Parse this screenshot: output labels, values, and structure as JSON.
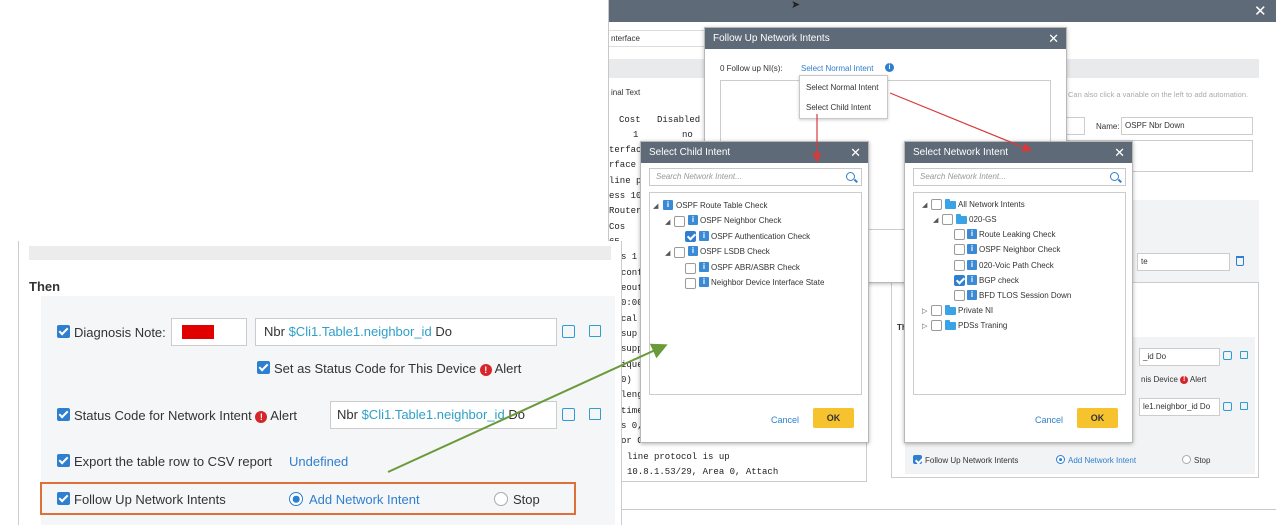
{
  "bg": {
    "interface_text": "nterface",
    "final_text": "inal Text",
    "table_header": [
      "Cost",
      "Disabled"
    ],
    "table_row": [
      "1",
      "no"
    ],
    "cli_lines": [
      "terface",
      "rface i",
      "line pr",
      "ess 10.",
      " Router",
      "   Cos",
      "   65",
      "s 1",
      "conf",
      "eout",
      "0:00",
      "cal",
      " sup",
      "supp",
      "ique",
      "0)",
      "leng",
      "time",
      "s 0,",
      "or C"
    ],
    "cli_bottom": [
      " line protocol is up",
      " 10.8.1.53/29, Area 0, Attach"
    ],
    "hint": "Can also click a variable on the left to add automation.",
    "name_label": "Name:",
    "name_value": "OSPF Nbr Down",
    "te_value": "te",
    "th_text": "Th",
    "do_value": "_id Do",
    "device_text": "nis Device",
    "alert_text": "Alert",
    "neighbor_value": "le1.neighbor_id Do",
    "follow_up": "Follow Up Network Intents",
    "add_ni": "Add Network Intent",
    "stop": "Stop"
  },
  "follow_dialog": {
    "title": "Follow Up Network Intents",
    "count_label": "0 Follow up NI(s):",
    "select_link": "Select Normal Intent",
    "menu": [
      "Select Normal Intent",
      "Select Child Intent"
    ]
  },
  "child_dialog": {
    "title": "Select Child Intent",
    "search_placeholder": "Search Network Intent...",
    "tree": [
      {
        "label": "OSPF Route Table Check",
        "checked": false,
        "level": 0,
        "toggle": "▲",
        "cb": false
      },
      {
        "label": "OSPF Neighbor Check",
        "checked": false,
        "level": 1,
        "toggle": "◢",
        "cb": true
      },
      {
        "label": "OSPF Authentication Check",
        "checked": true,
        "level": 2,
        "toggle": "",
        "cb": true
      },
      {
        "label": "OSPF LSDB Check",
        "checked": false,
        "level": 1,
        "toggle": "◢",
        "cb": true
      },
      {
        "label": "OSPF ABR/ASBR Check",
        "checked": false,
        "level": 2,
        "toggle": "",
        "cb": true
      },
      {
        "label": "Neighbor Device Interface State",
        "checked": false,
        "level": 2,
        "toggle": "",
        "cb": true
      }
    ],
    "cancel": "Cancel",
    "ok": "OK"
  },
  "network_dialog": {
    "title": "Select Network Intent",
    "search_placeholder": "Search Network Intent...",
    "tree": [
      {
        "label": "All Network Intents",
        "checked": false,
        "level": 0,
        "toggle": "◢",
        "type": "folder"
      },
      {
        "label": "020-GS",
        "checked": false,
        "level": 1,
        "toggle": "◢",
        "type": "folder"
      },
      {
        "label": "Route Leaking Check",
        "checked": false,
        "level": 2,
        "toggle": "",
        "type": "ni"
      },
      {
        "label": "OSPF Neighbor Check",
        "checked": false,
        "level": 2,
        "toggle": "",
        "type": "ni"
      },
      {
        "label": "020-Voic Path Check",
        "checked": false,
        "level": 2,
        "toggle": "",
        "type": "ni"
      },
      {
        "label": "BGP check",
        "checked": true,
        "level": 2,
        "toggle": "",
        "type": "ni"
      },
      {
        "label": "BFD TLOS Session Down",
        "checked": false,
        "level": 2,
        "toggle": "",
        "type": "ni"
      },
      {
        "label": "Private NI",
        "checked": false,
        "level": 0,
        "toggle": "▷",
        "type": "folder"
      },
      {
        "label": "PDSs Traning",
        "checked": false,
        "level": 0,
        "toggle": "▷",
        "type": "folder"
      }
    ],
    "cancel": "Cancel",
    "ok": "OK"
  },
  "zoom": {
    "then": "Then",
    "diag_label": "Diagnosis Note:",
    "diag_prefix": "Nbr",
    "diag_var": "$Cli1.Table1.neighbor_id",
    "diag_suffix": "Do",
    "status_set": "Set as Status Code for This Device",
    "alert": "Alert",
    "status_label": "Status Code for Network Intent",
    "status_prefix": "Nbr",
    "status_var": "$Cli1.Table1.neighbor_id",
    "status_suffix": "Do",
    "export_label": "Export the table row to CSV report",
    "export_value": "Undefined",
    "follow_label": "Follow Up Network Intents",
    "add_label": "Add Network Intent",
    "stop_label": "Stop"
  },
  "colors": {
    "accent": "#2f7fd0",
    "header": "#5e6a77",
    "ok": "#f6c22e",
    "alert": "#d7262b",
    "highlight_box": "#e0703a",
    "arrow_green": "#6a9a3a",
    "arrow_red": "#d83a3a"
  }
}
